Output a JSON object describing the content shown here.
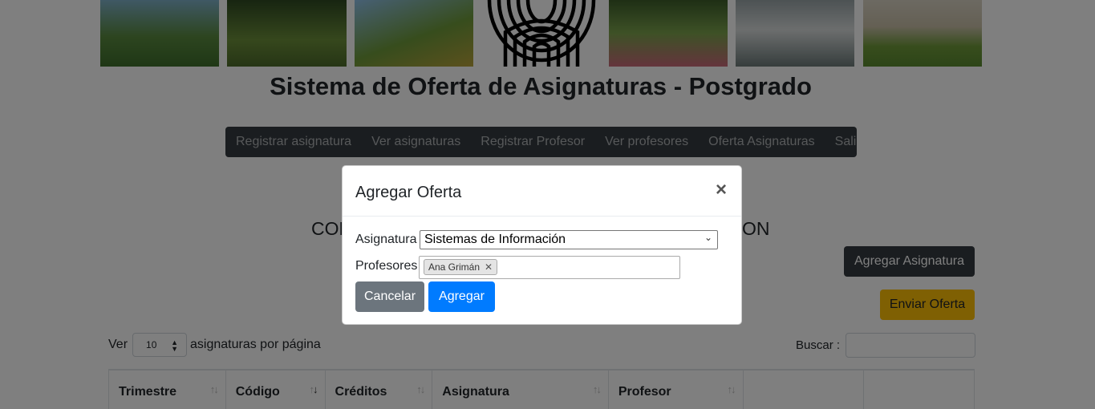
{
  "header": {
    "title": "Sistema de Oferta de Asignaturas - Postgrado"
  },
  "nav": {
    "items": [
      "Registrar asignatura",
      "Ver asignaturas",
      "Registrar Profesor",
      "Ver profesores",
      "Oferta Asignaturas",
      "Salir"
    ]
  },
  "section": {
    "heading_left": "CON",
    "heading_right": "ON"
  },
  "actions": {
    "add_subject": "Agregar Asignatura",
    "send_offer": "Enviar Oferta"
  },
  "table_controls": {
    "show_label": "Ver",
    "page_size": "10",
    "per_page_label": "asignaturas por página",
    "search_label": "Buscar :"
  },
  "table": {
    "columns": [
      "Trimestre",
      "Código",
      "Créditos",
      "Asignatura",
      "Profesor",
      "",
      ""
    ]
  },
  "modal": {
    "title": "Agregar Oferta",
    "close": "×",
    "subject_label": "Asignatura",
    "subject_value": "Sistemas de Información",
    "professors_label": "Profesores",
    "professors": [
      "Ana Grimán"
    ],
    "cancel": "Cancelar",
    "submit": "Agregar"
  },
  "colors": {
    "navbar": "#343a40",
    "warning": "#ffc107",
    "primary": "#007bff",
    "secondary": "#6c757d"
  }
}
